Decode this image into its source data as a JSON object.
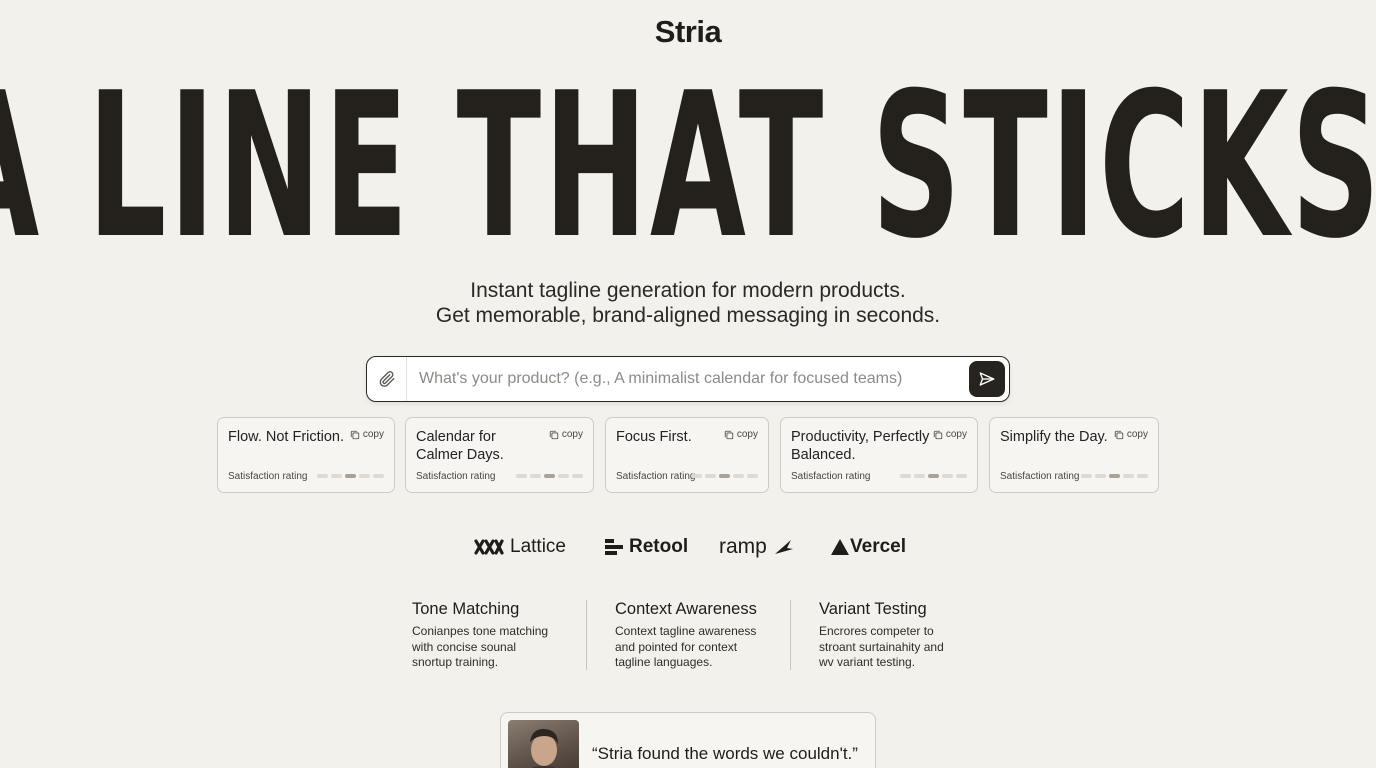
{
  "brand": {
    "name": "Stria"
  },
  "hero": {
    "headline": "A LINE THAT STICKS."
  },
  "subheadline": {
    "line1": "Instant tagline generation for modern products.",
    "line2": "Get memorable, brand-aligned messaging in seconds."
  },
  "search": {
    "placeholder": "What's your product? (e.g., A minimalist calendar for focused teams)",
    "value": ""
  },
  "cards": [
    {
      "title": "Flow. Not Friction.",
      "copy_label": "copy",
      "rating_label": "Satisfaction rating",
      "rating": 3
    },
    {
      "title": "Calendar for\nCalmer Days.",
      "copy_label": "copy",
      "rating_label": "Satisfaction rating",
      "rating": 3
    },
    {
      "title": "Focus First.",
      "copy_label": "copy",
      "rating_label": "Satisfaction rating",
      "rating": 3
    },
    {
      "title": "Productivity, Perfectly\nBalanced.",
      "copy_label": "copy",
      "rating_label": "Satisfaction rating",
      "rating": 3
    },
    {
      "title": "Simplify the Day.",
      "copy_label": "copy",
      "rating_label": "Satisfaction rating",
      "rating": 3
    }
  ],
  "logos": [
    {
      "name": "Lattice",
      "icon": "lattice-logo-icon"
    },
    {
      "name": "Retool",
      "icon": "retool-logo-icon"
    },
    {
      "name": "ramp",
      "icon": "ramp-logo-icon"
    },
    {
      "name": "Vercel",
      "icon": "vercel-triangle-icon"
    }
  ],
  "features": [
    {
      "title": "Tone Matching",
      "desc": "Conianpes tone matching with concise sounal snortup training."
    },
    {
      "title": "Context Awareness",
      "desc": "Context tagline awareness and pointed for context tagline languages."
    },
    {
      "title": "Variant Testing",
      "desc": "Encrores competer to stroant surtainahity and wv variant testing."
    }
  ],
  "testimonial": {
    "quote": "“Stria found the words we couldn't.”"
  },
  "colors": {
    "background": "#f3f1ec",
    "ink": "#24211d",
    "accent": "#27241f"
  },
  "icons": {
    "attach": "paperclip-icon",
    "send": "send-arrow-icon",
    "copy": "copy-icon"
  }
}
